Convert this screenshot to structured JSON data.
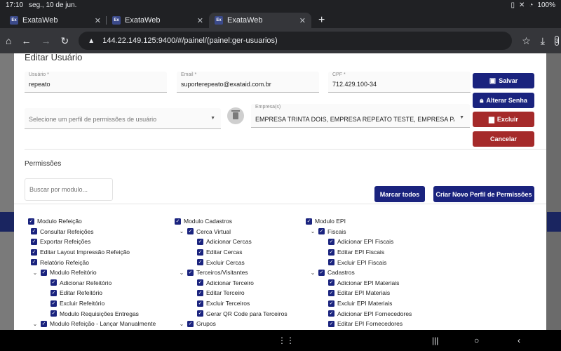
{
  "status_bar": {
    "time": "17:10",
    "date": "seg., 10 de jun.",
    "battery": "100%"
  },
  "browser": {
    "tabs": [
      {
        "label": "ExataWeb",
        "favicon": "Ex",
        "active": false
      },
      {
        "label": "ExataWeb",
        "favicon": "Ex",
        "active": false
      },
      {
        "label": "ExataWeb",
        "favicon": "Ex",
        "active": true
      }
    ],
    "url": "144.22.149.125:9400/#/painel/(painel:ger-usuarios)",
    "tab_count": "3"
  },
  "modal": {
    "title": "Editar Usuário",
    "fields": {
      "usuario": {
        "label": "Usuário *",
        "value": "repeato"
      },
      "email": {
        "label": "Email *",
        "value": "suporterepeato@exataid.com.br"
      },
      "cpf": {
        "label": "CPF *",
        "value": "712.429.100-34"
      },
      "perfil": {
        "placeholder": "Selecione um perfil de permissões de usuário"
      },
      "empresa": {
        "label": "Empresa(s)",
        "value": "EMPRESA TRINTA DOIS, EMPRESA REPEATO TESTE, EMPRESA PADRAO"
      }
    },
    "buttons": {
      "salvar": "Salvar",
      "alterar_senha": "Alterar Senha",
      "excluir": "Excluir",
      "cancelar": "Cancelar"
    },
    "permissions": {
      "title": "Permissões",
      "search_placeholder": "Buscar por modulo...",
      "mark_all": "Marcar todos",
      "new_profile": "Criar Novo Perfil de Permissões",
      "columns": [
        [
          {
            "label": "Modulo Refeição",
            "level": 0
          },
          {
            "label": "Consultar Refeições",
            "level": 1
          },
          {
            "label": "Exportar Refeições",
            "level": 1
          },
          {
            "label": "Editar Layout Impressão Refeição",
            "level": 1
          },
          {
            "label": "Relatório Refeição",
            "level": 1
          },
          {
            "label": "Modulo Refeitório",
            "level": 1,
            "expand": true
          },
          {
            "label": "Adicionar Refeitório",
            "level": 2
          },
          {
            "label": "Editar Refeitório",
            "level": 2
          },
          {
            "label": "Excluir Refeitório",
            "level": 2
          },
          {
            "label": "Modulo Requisições Entregas",
            "level": 2
          },
          {
            "label": "Modulo Refeição - Lançar Manualmente",
            "level": 1,
            "expand": true
          }
        ],
        [
          {
            "label": "Modulo Cadastros",
            "level": 0
          },
          {
            "label": "Cerca Virtual",
            "level": 1,
            "expand": true
          },
          {
            "label": "Adicionar Cercas",
            "level": 2
          },
          {
            "label": "Editar Cercas",
            "level": 2
          },
          {
            "label": "Excluir Cercas",
            "level": 2
          },
          {
            "label": "Terceiros/Visitantes",
            "level": 1,
            "expand": true
          },
          {
            "label": "Adicionar Terceiro",
            "level": 2
          },
          {
            "label": "Editar Terceiro",
            "level": 2
          },
          {
            "label": "Excluir Terceiros",
            "level": 2
          },
          {
            "label": "Gerar QR Code para Terceiros",
            "level": 2
          },
          {
            "label": "Grupos",
            "level": 1,
            "expand": true
          }
        ],
        [
          {
            "label": "Modulo EPI",
            "level": 0
          },
          {
            "label": "Fiscais",
            "level": 1,
            "expand": true
          },
          {
            "label": "Adicionar EPI Fiscais",
            "level": 2
          },
          {
            "label": "Editar EPI Fiscais",
            "level": 2
          },
          {
            "label": "Excluir EPI Fiscais",
            "level": 2
          },
          {
            "label": "Cadastros",
            "level": 1,
            "expand": true
          },
          {
            "label": "Adicionar EPI Materiais",
            "level": 2
          },
          {
            "label": "Editar EPI Materiais",
            "level": 2
          },
          {
            "label": "Excluir EPI Materiais",
            "level": 2
          },
          {
            "label": "Adicionar EPI Fornecedores",
            "level": 2
          },
          {
            "label": "Editar EPI Fornecedores",
            "level": 2
          }
        ]
      ]
    }
  },
  "colors": {
    "navy": "#1a237e",
    "red": "#a52a2a",
    "checkbox": "#1a237e"
  }
}
